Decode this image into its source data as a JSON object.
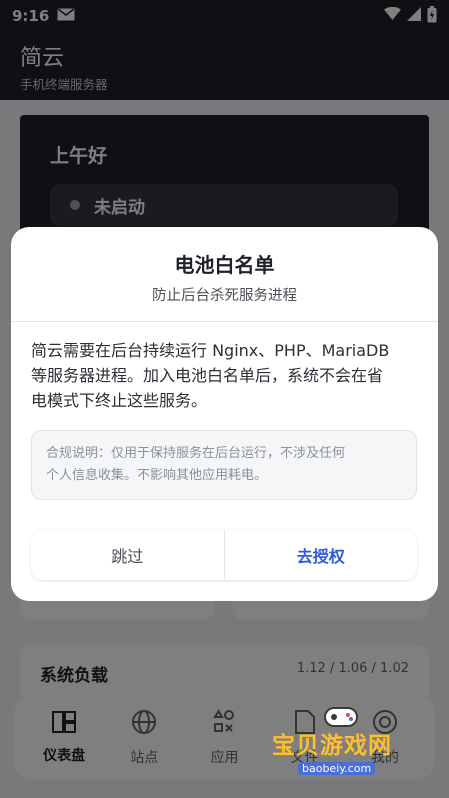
{
  "status_bar": {
    "time": "9:16"
  },
  "header": {
    "title": "简云",
    "subtitle": "手机终端服务器"
  },
  "dashboard": {
    "greeting": "上午好",
    "server_status": "未启动",
    "load_title": "系统负载",
    "load_values": "1.12 / 1.06 / 1.02"
  },
  "nav": {
    "items": [
      {
        "label": "仪表盘",
        "icon": "dashboard-icon"
      },
      {
        "label": "站点",
        "icon": "globe-icon"
      },
      {
        "label": "应用",
        "icon": "apps-icon"
      },
      {
        "label": "文件",
        "icon": "file-icon"
      },
      {
        "label": "我的",
        "icon": "user-icon"
      }
    ]
  },
  "dialog": {
    "title": "电池白名单",
    "subtitle": "防止后台杀死服务进程",
    "body_lines": [
      "简云需要在后台持续运行 Nginx、PHP、MariaDB",
      "等服务器进程。加入电池白名单后，系统不会在省",
      "电模式下终止这些服务。"
    ],
    "notice_lines": [
      "合规说明：仅用于保持服务在后台运行，不涉及任何",
      "个人信息收集。不影响其他应用耗电。"
    ],
    "skip_label": "跳过",
    "authorize_label": "去授权"
  },
  "watermark": {
    "text": "宝贝游戏网",
    "url": "baobeiy.com"
  },
  "colors": {
    "dark": "#1d2026",
    "accent": "#2f5bd8",
    "watermark": "#ffbe2b"
  }
}
